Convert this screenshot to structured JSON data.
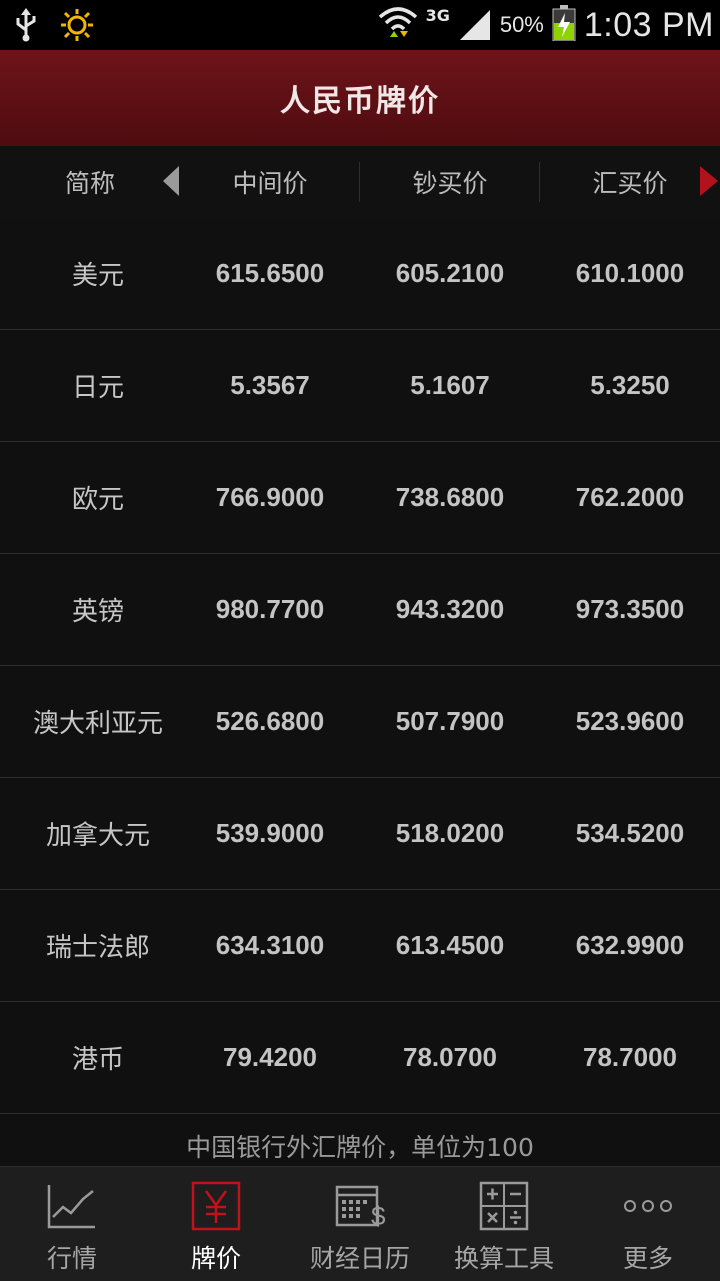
{
  "status_bar": {
    "time": "1:03 PM",
    "battery": "50%",
    "network": "3G",
    "icons": [
      "usb-icon",
      "brightness-icon",
      "wifi-icon",
      "signal-icon",
      "battery-charging-icon"
    ]
  },
  "header": {
    "title": "人民币牌价"
  },
  "columns": {
    "name": "简称",
    "middle": "中间价",
    "cash_buy": "钞买价",
    "transfer_buy": "汇买价"
  },
  "rows": [
    {
      "name": "美元",
      "middle": "615.6500",
      "cash_buy": "605.2100",
      "transfer_buy": "610.1000"
    },
    {
      "name": "日元",
      "middle": "5.3567",
      "cash_buy": "5.1607",
      "transfer_buy": "5.3250"
    },
    {
      "name": "欧元",
      "middle": "766.9000",
      "cash_buy": "738.6800",
      "transfer_buy": "762.2000"
    },
    {
      "name": "英镑",
      "middle": "980.7700",
      "cash_buy": "943.3200",
      "transfer_buy": "973.3500"
    },
    {
      "name": "澳大利亚元",
      "middle": "526.6800",
      "cash_buy": "507.7900",
      "transfer_buy": "523.9600"
    },
    {
      "name": "加拿大元",
      "middle": "539.9000",
      "cash_buy": "518.0200",
      "transfer_buy": "534.5200"
    },
    {
      "name": "瑞士法郎",
      "middle": "634.3100",
      "cash_buy": "613.4500",
      "transfer_buy": "632.9900"
    },
    {
      "name": "港币",
      "middle": "79.4200",
      "cash_buy": "78.0700",
      "transfer_buy": "78.7000"
    }
  ],
  "footnote": "中国银行外汇牌价，单位为100",
  "nav": [
    {
      "label": "行情",
      "icon": "line-chart-icon",
      "active": false
    },
    {
      "label": "牌价",
      "icon": "yuan-icon",
      "active": true
    },
    {
      "label": "财经日历",
      "icon": "calendar-dollar-icon",
      "active": false
    },
    {
      "label": "换算工具",
      "icon": "calculator-icon",
      "active": false
    },
    {
      "label": "更多",
      "icon": "more-dots-icon",
      "active": false
    }
  ],
  "colors": {
    "title_bar": "#6e1419",
    "accent_red": "#b2121c",
    "background": "#101010"
  }
}
